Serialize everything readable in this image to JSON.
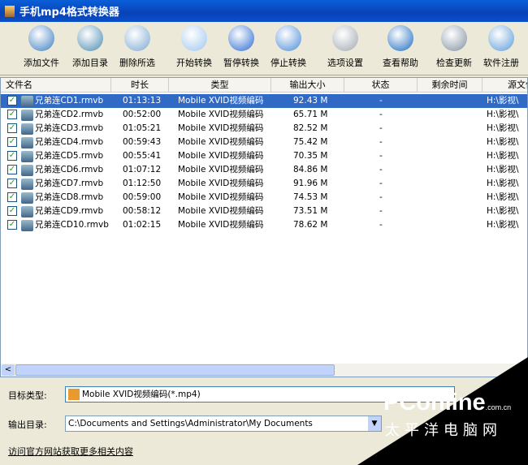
{
  "window": {
    "title": "手机mp4格式转换器"
  },
  "toolbar": [
    {
      "label": "添加文件",
      "icon": "add-file-icon",
      "color": "#3a7cc0"
    },
    {
      "label": "添加目录",
      "icon": "add-folder-icon",
      "color": "#4a8ab0"
    },
    {
      "label": "删除所选",
      "icon": "delete-icon",
      "color": "#7aa8d0"
    },
    {
      "label": "开始转换",
      "icon": "play-icon",
      "color": "#9cc6ee"
    },
    {
      "label": "暂停转换",
      "icon": "pause-icon",
      "color": "#2a6ad0"
    },
    {
      "label": "停止转换",
      "icon": "stop-icon",
      "color": "#4a8ad8"
    },
    {
      "label": "选项设置",
      "icon": "tools-icon",
      "color": "#a0a8b0"
    },
    {
      "label": "查看帮助",
      "icon": "help-icon",
      "color": "#1a6ac0"
    },
    {
      "label": "检查更新",
      "icon": "globe-update-icon",
      "color": "#8090a0"
    },
    {
      "label": "软件注册",
      "icon": "register-key-icon",
      "color": "#5a9ad8"
    }
  ],
  "columns": [
    "文件名",
    "时长",
    "类型",
    "输出大小",
    "状态",
    "剩余时间",
    "源文件路"
  ],
  "rows": [
    {
      "name": "兄弟连CD1.rmvb",
      "duration": "01:13:13",
      "type": "Mobile XVID视频编码",
      "size": "92.43 M",
      "status": "-",
      "path": "H:\\影视\\",
      "checked": true,
      "selected": true
    },
    {
      "name": "兄弟连CD2.rmvb",
      "duration": "00:52:00",
      "type": "Mobile XVID视频编码",
      "size": "65.71 M",
      "status": "-",
      "path": "H:\\影视\\",
      "checked": true
    },
    {
      "name": "兄弟连CD3.rmvb",
      "duration": "01:05:21",
      "type": "Mobile XVID视频编码",
      "size": "82.52 M",
      "status": "-",
      "path": "H:\\影视\\",
      "checked": true
    },
    {
      "name": "兄弟连CD4.rmvb",
      "duration": "00:59:43",
      "type": "Mobile XVID视频编码",
      "size": "75.42 M",
      "status": "-",
      "path": "H:\\影视\\",
      "checked": true
    },
    {
      "name": "兄弟连CD5.rmvb",
      "duration": "00:55:41",
      "type": "Mobile XVID视频编码",
      "size": "70.35 M",
      "status": "-",
      "path": "H:\\影视\\",
      "checked": true
    },
    {
      "name": "兄弟连CD6.rmvb",
      "duration": "01:07:12",
      "type": "Mobile XVID视频编码",
      "size": "84.86 M",
      "status": "-",
      "path": "H:\\影视\\",
      "checked": true
    },
    {
      "name": "兄弟连CD7.rmvb",
      "duration": "01:12:50",
      "type": "Mobile XVID视频编码",
      "size": "91.96 M",
      "status": "-",
      "path": "H:\\影视\\",
      "checked": true
    },
    {
      "name": "兄弟连CD8.rmvb",
      "duration": "00:59:00",
      "type": "Mobile XVID视频编码",
      "size": "74.53 M",
      "status": "-",
      "path": "H:\\影视\\",
      "checked": true
    },
    {
      "name": "兄弟连CD9.rmvb",
      "duration": "00:58:12",
      "type": "Mobile XVID视频编码",
      "size": "73.51 M",
      "status": "-",
      "path": "H:\\影视\\",
      "checked": true
    },
    {
      "name": "兄弟连CD10.rmvb",
      "duration": "01:02:15",
      "type": "Mobile XVID视频编码",
      "size": "78.62 M",
      "status": "-",
      "path": "H:\\影视\\",
      "checked": true
    }
  ],
  "settings": {
    "target_label": "目标类型:",
    "target_value": "Mobile XVID视频编码(*.mp4)",
    "output_label": "输出目录:",
    "output_value": "C:\\Documents and Settings\\Administrator\\My Documents"
  },
  "link": "访问官方网站获取更多相关内容",
  "watermark": {
    "logo": "PConline",
    "domain": ".com.cn",
    "sub": "太平洋电脑网"
  }
}
